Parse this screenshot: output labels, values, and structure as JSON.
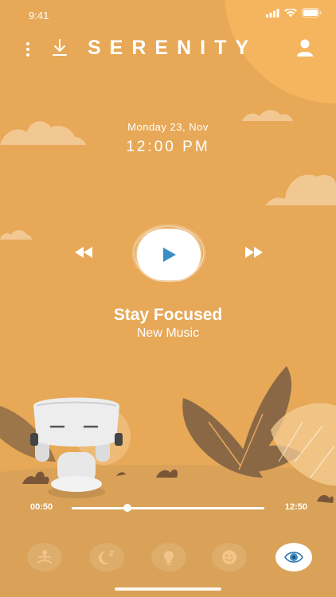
{
  "status_bar": {
    "time": "9:41"
  },
  "header": {
    "app_title": "SERENITY"
  },
  "now_playing": {
    "date": "Monday 23, Nov",
    "time": "12:00 PM",
    "track_title": "Stay Focused",
    "track_subtitle": "New Music"
  },
  "progress": {
    "current": "00:50",
    "total": "12:50",
    "fraction": 0.29
  },
  "tab_bar": {
    "items": [
      {
        "name": "meditation",
        "icon": "meditation-icon",
        "active": false
      },
      {
        "name": "sleep",
        "icon": "moon-icon",
        "active": false
      },
      {
        "name": "ideas",
        "icon": "lightbulb-icon",
        "active": false
      },
      {
        "name": "mood",
        "icon": "smiley-icon",
        "active": false
      },
      {
        "name": "focus",
        "icon": "eye-icon",
        "active": true
      }
    ]
  },
  "colors": {
    "background": "#e7a857",
    "accent": "#3a8fc6",
    "foliage": "#8a6846",
    "text": "#ffffff"
  }
}
